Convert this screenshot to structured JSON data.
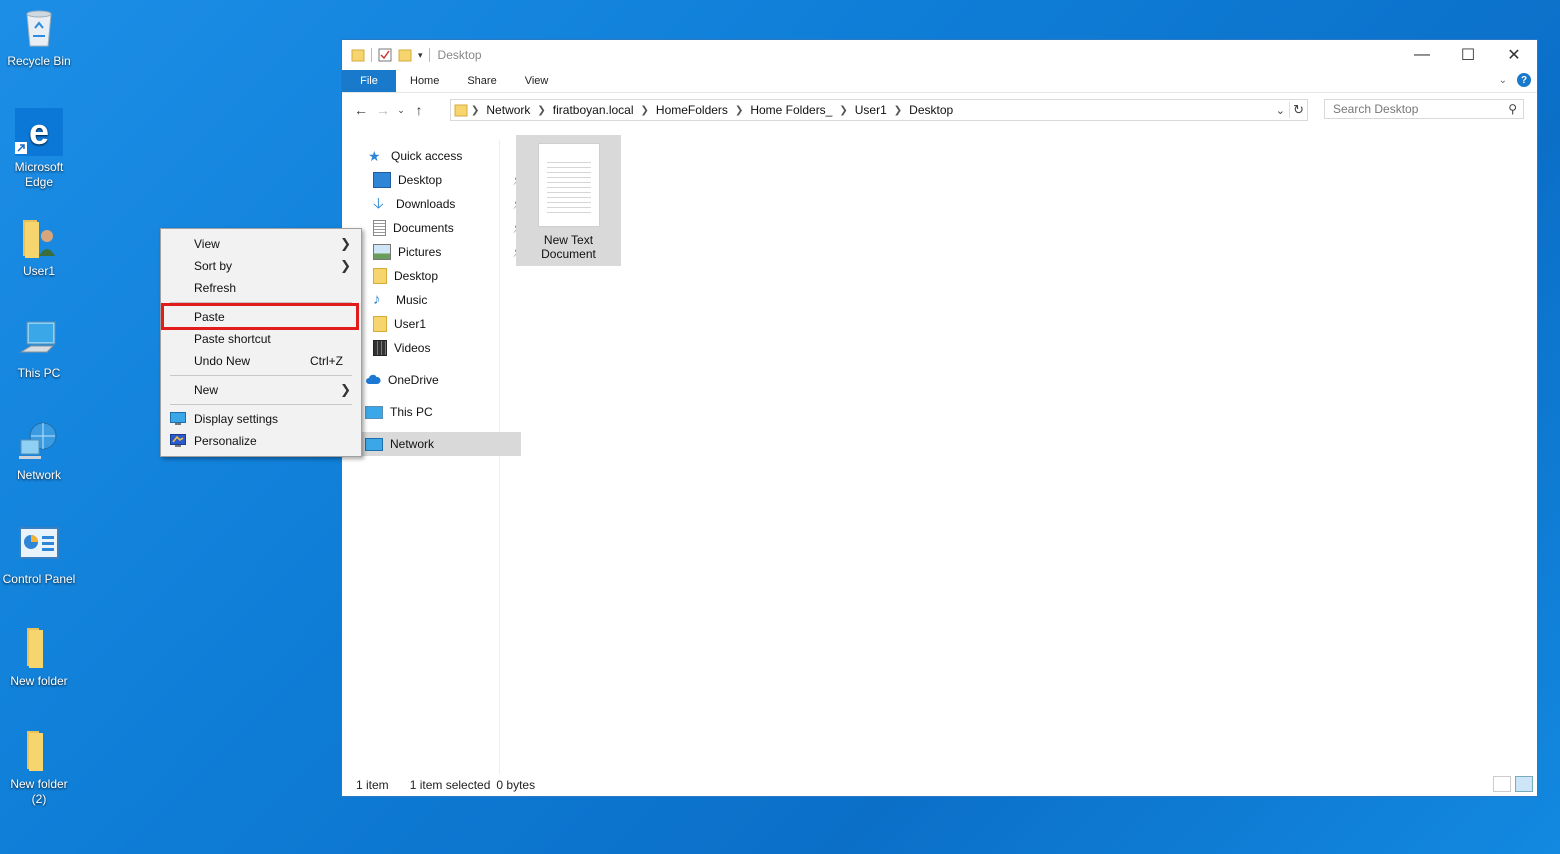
{
  "desktop": {
    "icons": [
      {
        "label": "Recycle Bin"
      },
      {
        "label": "Microsoft Edge"
      },
      {
        "label": "User1"
      },
      {
        "label": "This PC"
      },
      {
        "label": "Network"
      },
      {
        "label": "Control Panel"
      },
      {
        "label": "New folder"
      },
      {
        "label": "New folder (2)"
      }
    ]
  },
  "window": {
    "title": "Desktop",
    "ribbon_tabs": [
      "File",
      "Home",
      "Share",
      "View"
    ],
    "breadcrumb": [
      "Network",
      "firatboyan.local",
      "HomeFolders",
      "Home Folders_",
      "User1",
      "Desktop"
    ],
    "search_placeholder": "Search Desktop",
    "help": "?",
    "nav": {
      "quick_access": "Quick access",
      "items": [
        {
          "label": "Desktop",
          "pinned": true
        },
        {
          "label": "Downloads",
          "pinned": true
        },
        {
          "label": "Documents",
          "pinned": true
        },
        {
          "label": "Pictures",
          "pinned": true
        },
        {
          "label": "Desktop",
          "pinned": false
        },
        {
          "label": "Music",
          "pinned": false
        },
        {
          "label": "User1",
          "pinned": false
        },
        {
          "label": "Videos",
          "pinned": false
        }
      ],
      "onedrive": "OneDrive",
      "this_pc": "This PC",
      "network": "Network"
    },
    "files": [
      {
        "name_line1": "New Text",
        "name_line2": "Document"
      }
    ],
    "status": {
      "count": "1 item",
      "selection": "1 item selected",
      "size": "0 bytes"
    }
  },
  "context_menu": {
    "items": [
      {
        "label": "View",
        "submenu": true
      },
      {
        "label": "Sort by",
        "submenu": true
      },
      {
        "label": "Refresh"
      },
      {
        "label": "Paste",
        "highlighted": true
      },
      {
        "label": "Paste shortcut"
      },
      {
        "label": "Undo New",
        "shortcut": "Ctrl+Z"
      },
      {
        "label": "New",
        "submenu": true
      },
      {
        "label": "Display settings"
      },
      {
        "label": "Personalize"
      }
    ],
    "highlight_color": "#e21b1b"
  }
}
